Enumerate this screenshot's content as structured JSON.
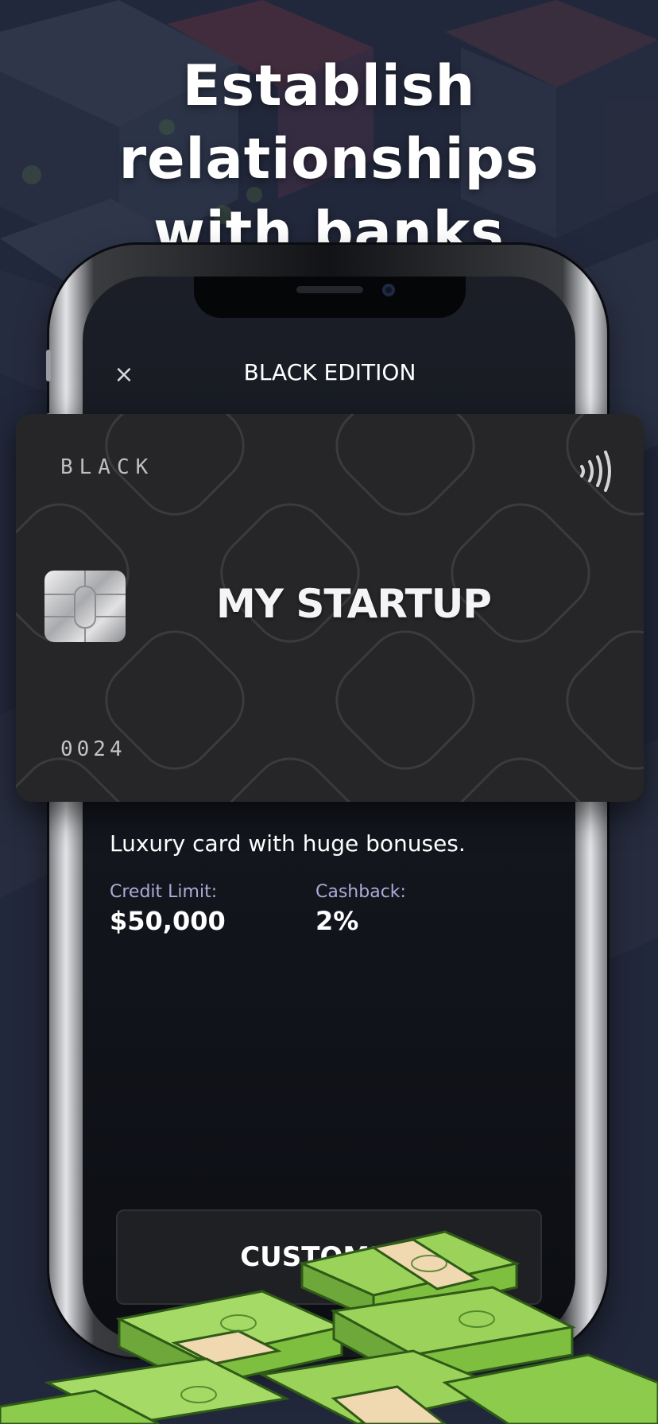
{
  "headline": {
    "line1": "Establish relationships",
    "line2": "with banks"
  },
  "screen": {
    "title": "BLACK EDITION",
    "close_icon": "×"
  },
  "card": {
    "tier": "BLACK",
    "brand": "MY STARTUP",
    "number": "0024",
    "chip_icon": "chip-icon",
    "contactless_icon": "contactless-icon"
  },
  "details": {
    "description": "Luxury card with huge bonuses.",
    "credit_limit_label": "Credit Limit:",
    "credit_limit_value": "$50,000",
    "cashback_label": "Cashback:",
    "cashback_value": "2%"
  },
  "actions": {
    "customize_label": "CUSTOMIZE"
  },
  "colors": {
    "background": "#22283b",
    "card": "#262628",
    "stat_label": "#b0a9d8",
    "money_green": "#7fbf3f"
  }
}
